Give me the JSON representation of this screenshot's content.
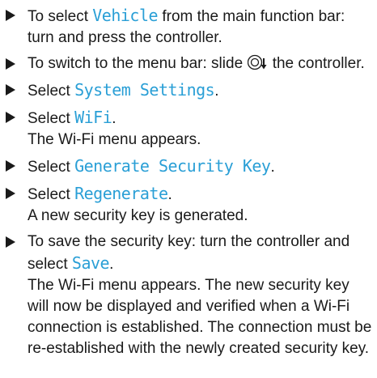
{
  "steps": [
    {
      "pre": "To select ",
      "menu": "Vehicle",
      "post": " from the main function bar: turn and press the controller."
    },
    {
      "pre": "To switch to the menu bar: slide ",
      "icon": "controller-slide-down-icon",
      "post": " the con­troller."
    },
    {
      "pre": "Select ",
      "menu": "System Settings",
      "post": "."
    },
    {
      "pre": "Select ",
      "menu": "WiFi",
      "post": ".",
      "result": "The Wi-Fi menu appears."
    },
    {
      "pre": "Select ",
      "menu": "Generate Security Key",
      "post": "."
    },
    {
      "pre": "Select ",
      "menu": "Regenerate",
      "post": ".",
      "result": "A new security key is generated."
    },
    {
      "pre": "To save the security key: turn the controller and select ",
      "menu": "Save",
      "post": ".",
      "result": "The Wi-Fi menu appears. The new security key will now be displayed and verified when a Wi-Fi connection is established. The connection must be re-established with the newly cre­ated security key."
    }
  ],
  "colors": {
    "text": "#1a1a1a",
    "menu_item": "#2a9fd6"
  }
}
